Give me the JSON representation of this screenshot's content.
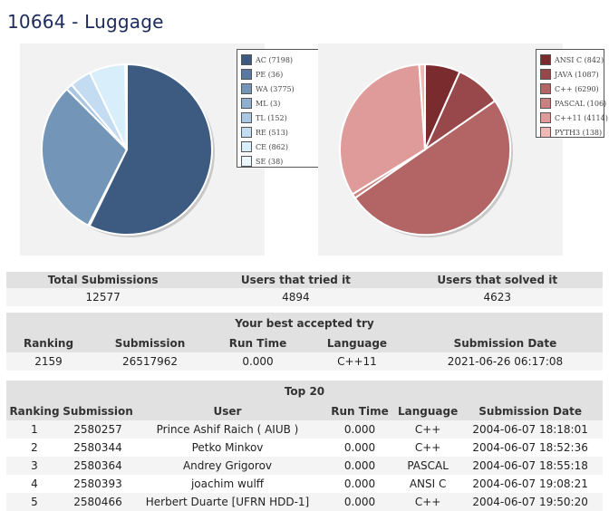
{
  "page": {
    "title": "10664 - Luggage"
  },
  "chart_data": [
    {
      "type": "pie",
      "categories": [
        "AC",
        "PE",
        "WA",
        "ML",
        "TL",
        "RE",
        "CE",
        "SE"
      ],
      "values": [
        7198,
        36,
        3775,
        3,
        152,
        513,
        862,
        38
      ],
      "legend": [
        "AC (7198)",
        "PE (36)",
        "WA (3775)",
        "ML (3)",
        "TL (152)",
        "RE (513)",
        "CE (862)",
        "SE (38)"
      ],
      "colors": [
        "#3d5a80",
        "#587aa0",
        "#7395b8",
        "#8eafd0",
        "#a9c7e3",
        "#c3dcf1",
        "#d9eefb",
        "#eaf7fd"
      ],
      "legend_position": "right"
    },
    {
      "type": "pie",
      "categories": [
        "ANSI C",
        "JAVA",
        "C++",
        "PASCAL",
        "C++11",
        "PYTH3"
      ],
      "values": [
        842,
        1087,
        6290,
        106,
        4114,
        138
      ],
      "legend": [
        "ANSI C (842)",
        "JAVA (1087)",
        "C++ (6290)",
        "PASCAL (106)",
        "C++11 (4114)",
        "PYTH3 (138)"
      ],
      "colors": [
        "#7a2b2e",
        "#98484a",
        "#b36566",
        "#c98180",
        "#df9b99",
        "#f0b8b5"
      ],
      "legend_position": "right"
    }
  ],
  "stats": {
    "headers": [
      "Total Submissions",
      "Users that tried it",
      "Users that solved it"
    ],
    "values": [
      "12577",
      "4894",
      "4623"
    ]
  },
  "best": {
    "caption": "Your best accepted try",
    "headers": [
      "Ranking",
      "Submission",
      "Run Time",
      "Language",
      "Submission Date"
    ],
    "row": [
      "2159",
      "26517962",
      "0.000",
      "C++11",
      "2021-06-26 06:17:08"
    ]
  },
  "top20": {
    "caption": "Top 20",
    "headers": [
      "Ranking",
      "Submission",
      "User",
      "Run Time",
      "Language",
      "Submission Date"
    ],
    "rows": [
      [
        "1",
        "2580257",
        "Prince Ashif Raich ( AIUB )",
        "0.000",
        "C++",
        "2004-06-07 18:18:01"
      ],
      [
        "2",
        "2580344",
        "Petko Minkov",
        "0.000",
        "C++",
        "2004-06-07 18:52:36"
      ],
      [
        "3",
        "2580364",
        "Andrey Grigorov",
        "0.000",
        "PASCAL",
        "2004-06-07 18:55:18"
      ],
      [
        "4",
        "2580393",
        "joachim wulff",
        "0.000",
        "ANSI C",
        "2004-06-07 19:08:21"
      ],
      [
        "5",
        "2580466",
        "Herbert Duarte [UFRN HDD-1]",
        "0.000",
        "C++",
        "2004-06-07 19:50:20"
      ]
    ]
  }
}
